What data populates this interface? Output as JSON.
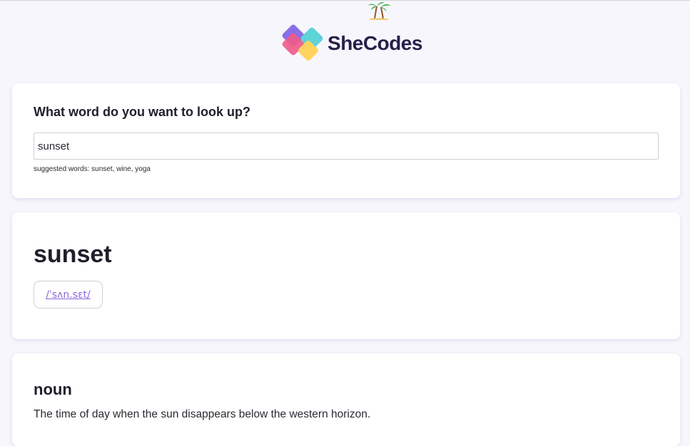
{
  "brand": {
    "name": "SheCodes",
    "colors": {
      "pink": "#ef5b8a",
      "purple": "#8a6ee8",
      "teal": "#5ed3d8",
      "yellow": "#ffd35e",
      "text": "#27204a"
    }
  },
  "search": {
    "title": "What word do you want to look up?",
    "value": "sunset",
    "hint": "suggested words: sunset, wine, yoga"
  },
  "result": {
    "word": "sunset",
    "phonetic": "/ˈsʌn.sɛt/"
  },
  "meanings": [
    {
      "part_of_speech": "noun",
      "definition": "The time of day when the sun disappears below the western horizon."
    }
  ],
  "icons": {
    "logo": "shecodes-logo-icon",
    "palm": "palm-tree-icon"
  }
}
